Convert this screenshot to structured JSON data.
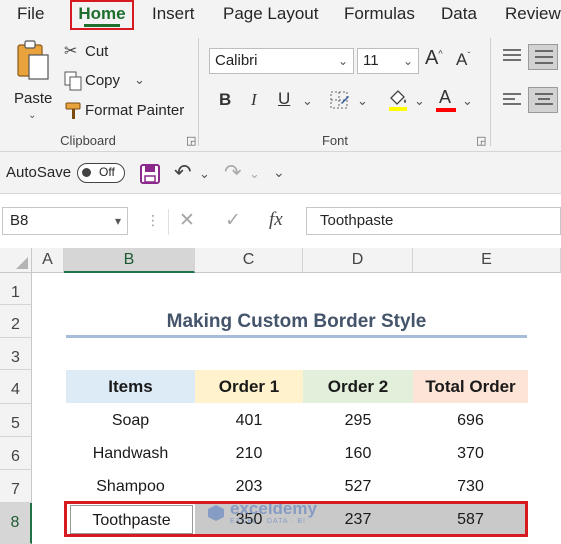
{
  "ribbon_tabs": [
    "File",
    "Home",
    "Insert",
    "Page Layout",
    "Formulas",
    "Data",
    "Review"
  ],
  "clipboard": {
    "paste": "Paste",
    "cut": "Cut",
    "copy": "Copy",
    "format_painter": "Format Painter",
    "group_label": "Clipboard"
  },
  "font": {
    "name": "Calibri",
    "size": "11",
    "group_label": "Font",
    "fill_color": "#ffff00",
    "font_color": "#ff0000"
  },
  "qat": {
    "autosave_label": "AutoSave",
    "toggle_state": "Off"
  },
  "formula_bar": {
    "name_box": "B8",
    "fx": "fx",
    "value": "Toothpaste"
  },
  "columns": [
    "A",
    "B",
    "C",
    "D",
    "E"
  ],
  "rows": [
    "1",
    "2",
    "3",
    "4",
    "5",
    "6",
    "7",
    "8"
  ],
  "sheet": {
    "title": "Making Custom Border Style",
    "headers": [
      "Items",
      "Order 1",
      "Order 2",
      "Total Order"
    ],
    "header_colors": [
      "#ddebf7",
      "#fff2cc",
      "#e2efda",
      "#fce4d6"
    ],
    "data": [
      [
        "Soap",
        "401",
        "295",
        "696"
      ],
      [
        "Handwash",
        "210",
        "160",
        "370"
      ],
      [
        "Shampoo",
        "203",
        "527",
        "730"
      ],
      [
        "Toothpaste",
        "350",
        "237",
        "587"
      ]
    ]
  },
  "watermark": {
    "name": "exceldemy",
    "tagline": "EXCEL · DATA · BI"
  }
}
